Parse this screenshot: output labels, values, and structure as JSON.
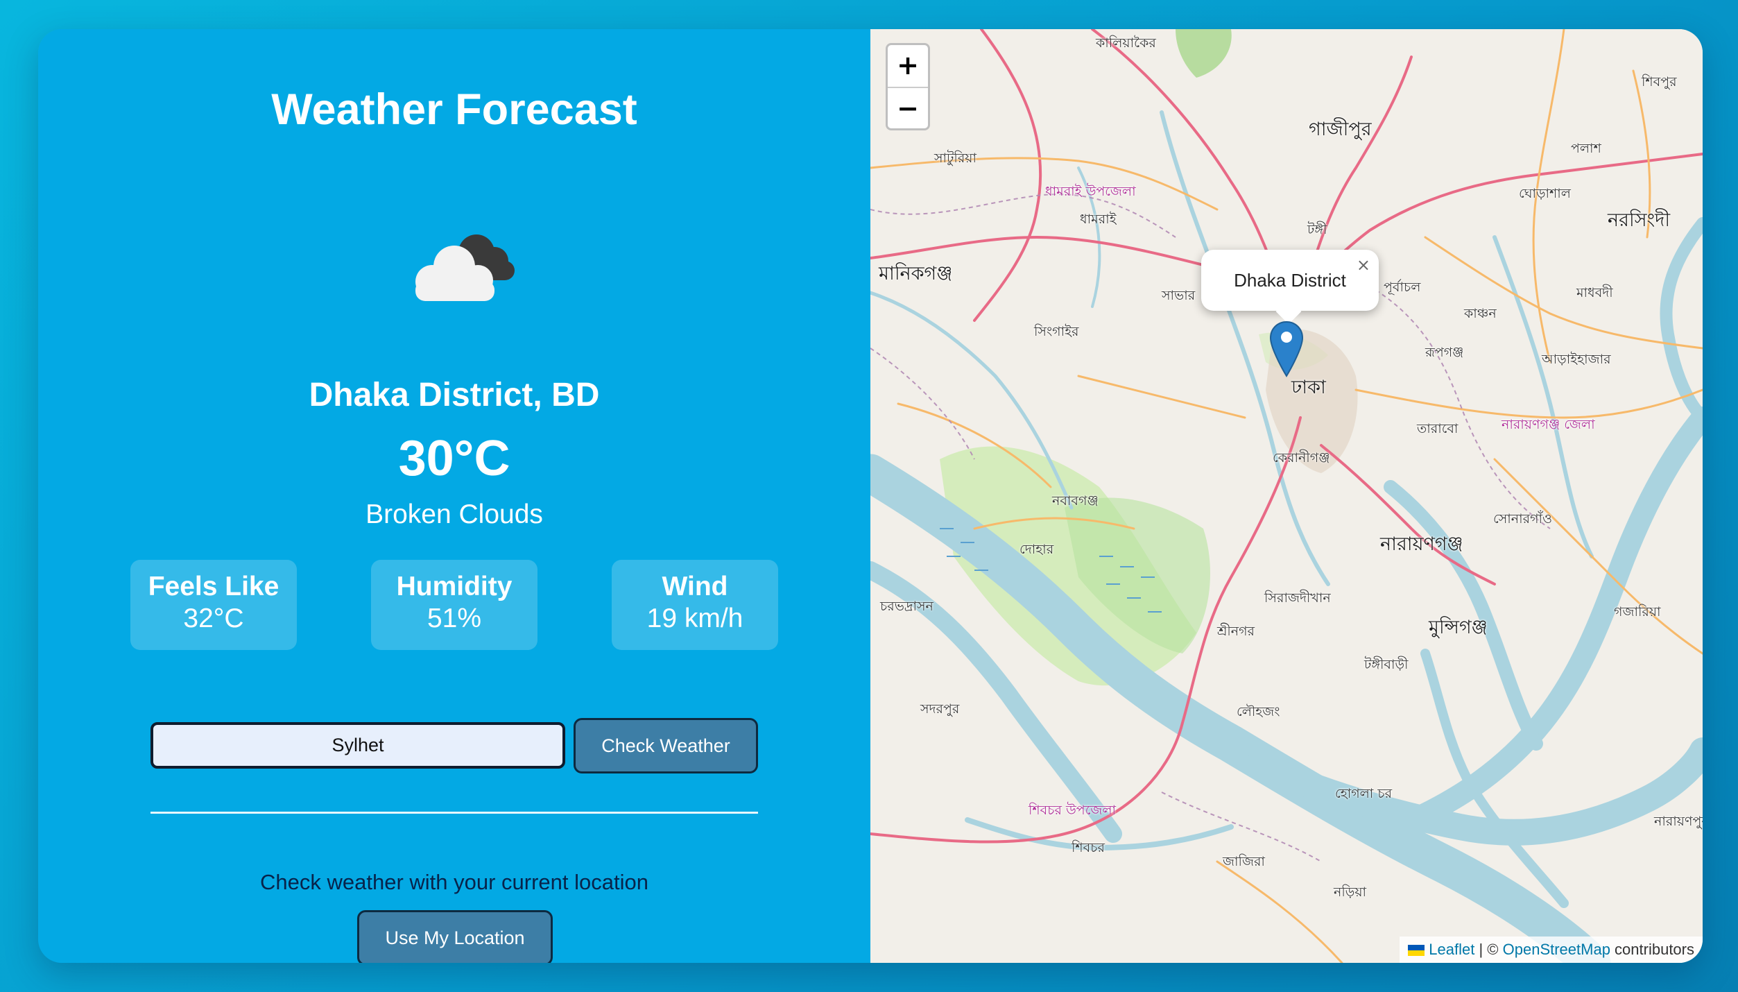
{
  "app": {
    "title": "Weather Forecast"
  },
  "current": {
    "icon": "broken-clouds-icon",
    "location": "Dhaka District, BD",
    "temperature": "30°C",
    "description": "Broken Clouds"
  },
  "metrics": [
    {
      "label": "Feels Like",
      "value": "32°C"
    },
    {
      "label": "Humidity",
      "value": "51%"
    },
    {
      "label": "Wind",
      "value": "19 km/h"
    }
  ],
  "search": {
    "value": "Sylhet",
    "button_label": "Check Weather"
  },
  "geolocation": {
    "prompt": "Check weather with your current location",
    "button_label": "Use My Location"
  },
  "map": {
    "zoom_in_label": "+",
    "zoom_out_label": "−",
    "popup_text": "Dhaka District",
    "popup_close": "×",
    "attribution": {
      "leaflet": "Leaflet",
      "separator": " | © ",
      "osm": "OpenStreetMap",
      "suffix": " contributors"
    },
    "labels": [
      "কালিয়াকৈর",
      "গাজীপুর",
      "শিবপুর",
      "পলাশ",
      "সাটুরিয়া",
      "ধামরাই উপজেলা",
      "ধামরাই",
      "টঙ্গী",
      "ঘোড়াশাল",
      "নরসিংদী",
      "মানিকগঞ্জ",
      "সাভার",
      "পূর্বাচল",
      "মাধবদী",
      "কাঞ্চন",
      "সিংগাইর",
      "রূপগঞ্জ",
      "আড়াইহাজার",
      "ঢাকা",
      "তারাবো",
      "নারায়ণগঞ্জ জেলা",
      "কেরানীগঞ্জ",
      "নবাবগঞ্জ",
      "দোহার",
      "নারায়ণগঞ্জ",
      "সোনারগাঁও",
      "সিরাজদীখান",
      "শ্রীনগর",
      "মুন্সিগঞ্জ",
      "গজারিয়া",
      "টঙ্গীবাড়ী",
      "চরভদ্রাসন",
      "সদরপুর",
      "লৌহজং",
      "হোগলা চর",
      "শিবচর উপজেলা",
      "শিবচর",
      "জাজিরা",
      "নড়িয়া",
      "নারায়ণপুর"
    ]
  },
  "colors": {
    "panel": "#03a9e4",
    "button": "#3d7ea6",
    "input_bg": "#e7effc",
    "marker": "#2a81cb",
    "water": "#aad3df"
  }
}
